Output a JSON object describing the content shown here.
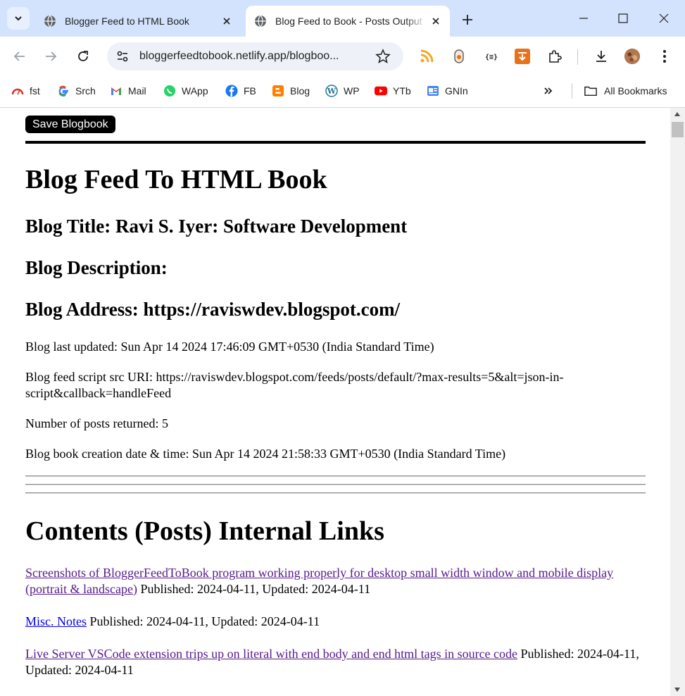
{
  "browser": {
    "tabs": [
      {
        "title": "Blogger Feed to HTML Book",
        "active": false
      },
      {
        "title": "Blog Feed to Book - Posts Output",
        "active": true
      }
    ],
    "url": "bloggerfeedtobook.netlify.app/blogboo...",
    "bookmarks": [
      {
        "label": "fst",
        "icon": "gauge-icon"
      },
      {
        "label": "Srch",
        "icon": "google-icon"
      },
      {
        "label": "Mail",
        "icon": "gmail-icon"
      },
      {
        "label": "WApp",
        "icon": "whatsapp-icon"
      },
      {
        "label": "FB",
        "icon": "facebook-icon"
      },
      {
        "label": "Blog",
        "icon": "blogger-icon"
      },
      {
        "label": "WP",
        "icon": "wordpress-icon"
      },
      {
        "label": "YTb",
        "icon": "youtube-icon"
      },
      {
        "label": "GNIn",
        "icon": "google-news-icon"
      }
    ],
    "all_bookmarks_label": "All Bookmarks"
  },
  "page": {
    "save_button": "Save Blogbook",
    "heading": "Blog Feed To HTML Book",
    "blog_title": "Blog Title: Ravi S. Iyer: Software Development",
    "blog_description": "Blog Description:",
    "blog_address": "Blog Address: https://raviswdev.blogspot.com/",
    "last_updated": "Blog last updated: Sun Apr 14 2024 17:46:09 GMT+0530 (India Standard Time)",
    "feed_uri": "Blog feed script src URI: https://raviswdev.blogspot.com/feeds/posts/default/?max-results=5&alt=json-in-script&callback=handleFeed",
    "num_posts": "Number of posts returned: 5",
    "creation_date": "Blog book creation date & time: Sun Apr 14 2024 21:58:33 GMT+0530 (India Standard Time)",
    "contents_heading": "Contents (Posts) Internal Links",
    "posts": [
      {
        "title": "Screenshots of BloggerFeedToBook program working properly for desktop small width window and mobile display (portrait & landscape)",
        "meta": " Published: 2024-04-11, Updated: 2024-04-11",
        "visited": true
      },
      {
        "title": "Misc. Notes",
        "meta": " Published: 2024-04-11, Updated: 2024-04-11",
        "visited": false
      },
      {
        "title": "Live Server VSCode extension trips up on literal with end body and end html tags in source code",
        "meta": " Published: 2024-04-11, Updated: 2024-04-11",
        "visited": true
      }
    ]
  },
  "colors": {
    "chrome_bg": "#d3e3fd",
    "visited_link": "#551a8b",
    "unvisited_link": "#0000ee"
  }
}
